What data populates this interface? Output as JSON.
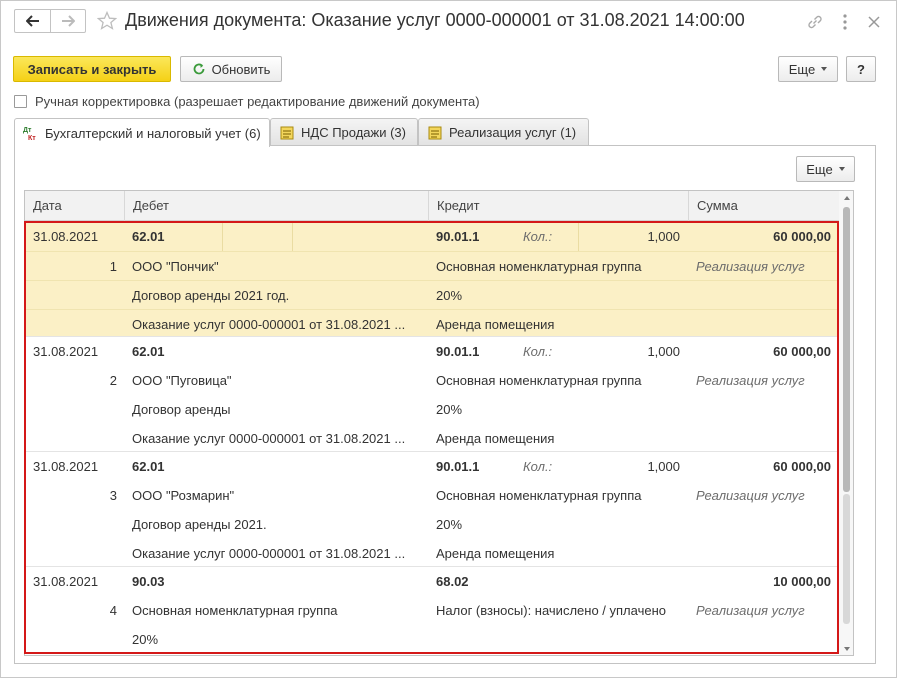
{
  "title": "Движения документа: Оказание услуг 0000-000001 от 31.08.2021 14:00:00",
  "toolbar": {
    "save_close": "Записать и закрыть",
    "refresh": "Обновить",
    "more": "Еще",
    "help": "?"
  },
  "manual_correction": "Ручная корректировка (разрешает редактирование движений документа)",
  "tabs": [
    {
      "label": "Бухгалтерский и налоговый учет (6)",
      "icon": "accounting-icon"
    },
    {
      "label": "НДС Продажи (3)",
      "icon": "register-icon"
    },
    {
      "label": "Реализация услуг (1)",
      "icon": "register-icon"
    }
  ],
  "panel_more": "Еще",
  "columns": {
    "date": "Дата",
    "debit": "Дебет",
    "credit": "Кредит",
    "sum": "Сумма"
  },
  "qty_label": "Кол.:",
  "records": [
    {
      "date": "31.08.2021",
      "num": "1",
      "debit_account": "62.01",
      "debit_lines": [
        "ООО \"Пончик\"",
        "Договор аренды 2021 год.",
        "Оказание услуг 0000-000001 от 31.08.2021 ..."
      ],
      "credit_account": "90.01.1",
      "qty": "1,000",
      "credit_lines": [
        "Основная номенклатурная группа",
        "20%",
        "Аренда помещения"
      ],
      "sum": "60 000,00",
      "content": "Реализация услуг"
    },
    {
      "date": "31.08.2021",
      "num": "2",
      "debit_account": "62.01",
      "debit_lines": [
        "ООО \"Пуговица\"",
        "Договор аренды",
        "Оказание услуг 0000-000001 от 31.08.2021 ..."
      ],
      "credit_account": "90.01.1",
      "qty": "1,000",
      "credit_lines": [
        "Основная номенклатурная группа",
        "20%",
        "Аренда помещения"
      ],
      "sum": "60 000,00",
      "content": "Реализация услуг"
    },
    {
      "date": "31.08.2021",
      "num": "3",
      "debit_account": "62.01",
      "debit_lines": [
        "ООО \"Розмарин\"",
        "Договор аренды 2021.",
        "Оказание услуг 0000-000001 от 31.08.2021 ..."
      ],
      "credit_account": "90.01.1",
      "qty": "1,000",
      "credit_lines": [
        "Основная номенклатурная группа",
        "20%",
        "Аренда помещения"
      ],
      "sum": "60 000,00",
      "content": "Реализация услуг"
    },
    {
      "date": "31.08.2021",
      "num": "4",
      "debit_account": "90.03",
      "debit_lines": [
        "Основная номенклатурная группа",
        "20%",
        ""
      ],
      "credit_account": "68.02",
      "qty": "",
      "credit_lines": [
        "Налог (взносы): начислено / уплачено",
        "",
        ""
      ],
      "sum": "10 000,00",
      "content": "Реализация услуг"
    }
  ],
  "colors": {
    "primary_button": "#f5d116",
    "selected_row": "#fbf0c6",
    "highlight": "#d41818"
  }
}
